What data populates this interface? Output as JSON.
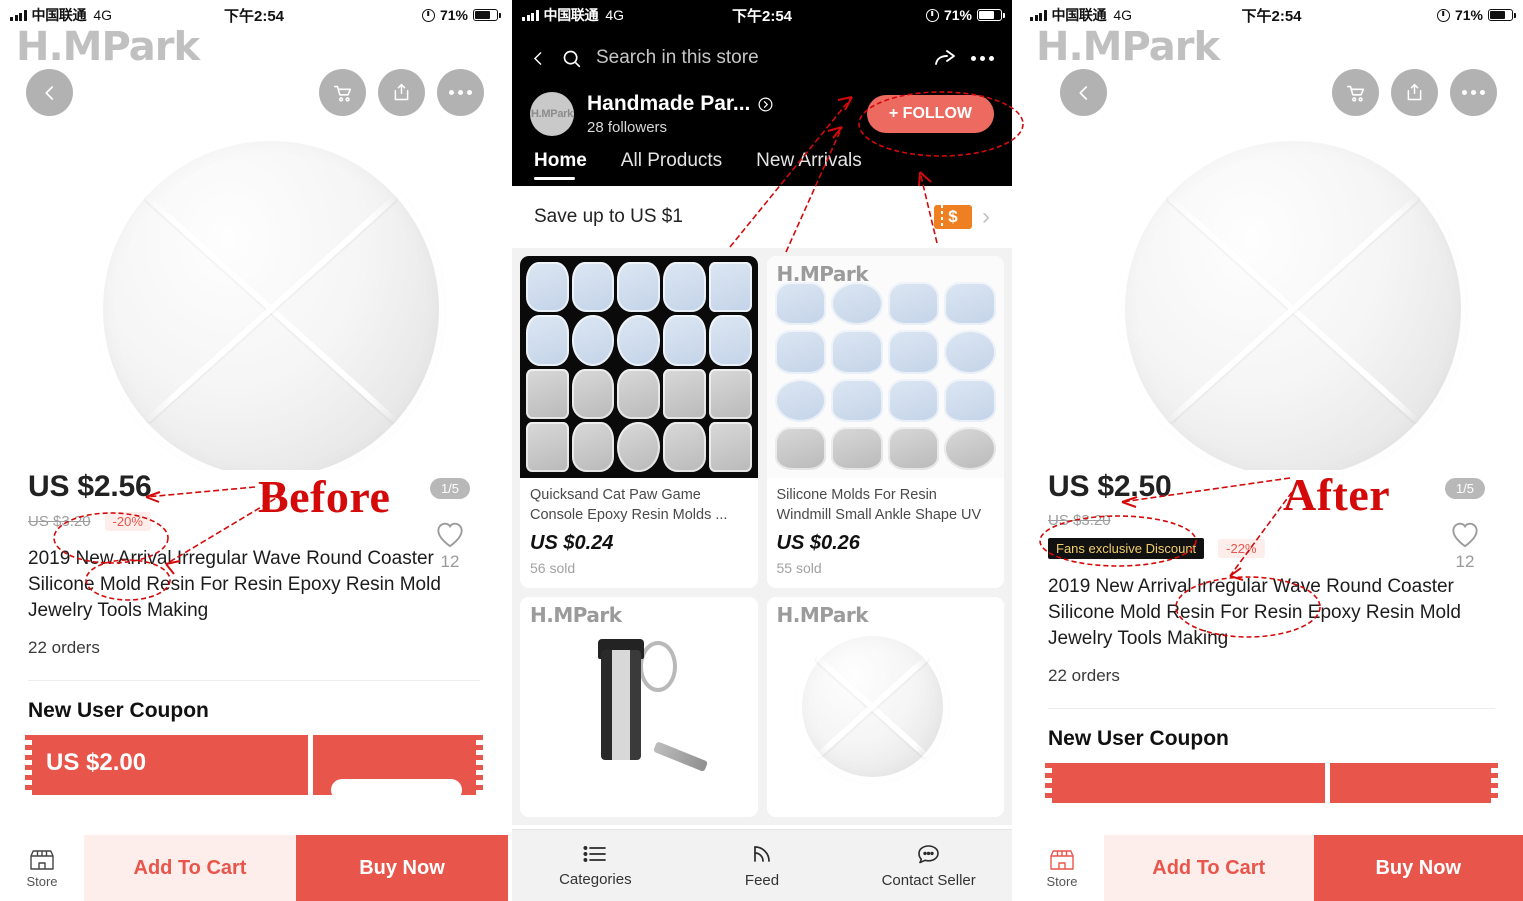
{
  "status_bar": {
    "carrier": "中国联通",
    "network": "4G",
    "time": "下午2:54",
    "battery_pct": "71%",
    "lock_icon": "rotation-lock-icon",
    "signal_icon": "signal-bars-icon",
    "battery_icon": "battery-icon"
  },
  "left_panel": {
    "label": "Before",
    "watermark": "H.MPark",
    "hero": {
      "back_icon": "back-chevron-icon",
      "cart_icon": "shopping-cart-icon",
      "share_icon": "share-icon",
      "more_icon": "more-dots-icon",
      "product_image": "round-coaster-silicone-mold"
    },
    "pager": "1/5",
    "favorite_icon": "heart-outline-icon",
    "favorite_count": "12",
    "price": "US $2.56",
    "price_old": "US $3.20",
    "discount": "-20%",
    "title": "2019 New Arrival Irregular Wave Round Coaster Silicone Mold Resin For Resin  Epoxy Resin Mold Jewelry Tools Making",
    "orders": "22 orders",
    "coupon_heading": "New User Coupon",
    "coupon_amount": "US $2.00",
    "bottom_bar": {
      "store_label": "Store",
      "store_icon": "storefront-icon",
      "add_to_cart": "Add To Cart",
      "buy_now": "Buy Now"
    }
  },
  "right_panel": {
    "label": "After",
    "watermark": "H.MPark",
    "hero": {
      "back_icon": "back-chevron-icon",
      "cart_icon": "shopping-cart-icon",
      "share_icon": "share-icon",
      "more_icon": "more-dots-icon",
      "product_image": "round-coaster-silicone-mold"
    },
    "pager": "1/5",
    "favorite_icon": "heart-outline-icon",
    "favorite_count": "12",
    "price": "US $2.50",
    "price_old": "US $3.20",
    "fans_badge": "Fans exclusive Discount",
    "discount": "-22%",
    "title": "2019 New Arrival Irregular Wave Round Coaster Silicone Mold Resin For Resin  Epoxy Resin Mold Jewelry Tools Making",
    "orders": "22 orders",
    "coupon_heading": "New User Coupon",
    "bottom_bar": {
      "store_label": "Store",
      "store_icon": "storefront-icon",
      "add_to_cart": "Add To Cart",
      "buy_now": "Buy Now"
    }
  },
  "middle_panel": {
    "header": {
      "back_icon": "back-chevron-icon",
      "search_icon": "search-icon",
      "search_placeholder": "Search in this store",
      "share_icon": "share-arrow-icon",
      "more_icon": "more-dots-icon",
      "avatar_text": "H.MPark",
      "store_name": "Handmade Par...",
      "store_info_icon": "chevron-right-circle-icon",
      "followers": "28  followers",
      "follow_button": "+ FOLLOW",
      "tabs": [
        {
          "label": "Home",
          "active": true
        },
        {
          "label": "All Products",
          "active": false
        },
        {
          "label": "New Arrivals",
          "active": false
        }
      ]
    },
    "save_bar": {
      "text": "Save up to US $1",
      "coupon_icon": "dollar-coupon-icon",
      "coupon_glyph": "$",
      "chevron_icon": "chevron-right-icon"
    },
    "products": [
      {
        "title": "Quicksand Cat Paw Game Console Epoxy Resin Molds ...",
        "price": "US $0.24",
        "sold": "56 sold",
        "image": "cat-paw-game-console-mold-sheet-dark",
        "watermark": ""
      },
      {
        "title": "Silicone Molds For Resin Windmill Small Ankle Shape UV ...",
        "price": "US $0.26",
        "sold": "55 sold",
        "image": "assorted-shape-molds-sheet-light",
        "watermark": "H.MPark"
      },
      {
        "title": "",
        "price": "",
        "sold": "",
        "image": "keychain-capsule-product",
        "watermark": "H.MPark"
      },
      {
        "title": "",
        "price": "",
        "sold": "",
        "image": "round-coaster-silicone-mold",
        "watermark": "H.MPark"
      }
    ],
    "bottom_nav": [
      {
        "label": "Categories",
        "icon": "list-icon"
      },
      {
        "label": "Feed",
        "icon": "rss-feed-icon"
      },
      {
        "label": "Contact Seller",
        "icon": "chat-bubble-icon"
      }
    ]
  },
  "annotations": {
    "before_label": "Before",
    "after_label": "After",
    "color": "#d40a0a"
  },
  "colors": {
    "brand_red": "#e8554b",
    "follow_red": "#ed6a60",
    "coupon_orange": "#ef8021",
    "fans_badge_bg": "#111111",
    "fans_badge_text": "#f3cf6a",
    "annotation_red": "#d40a0a"
  }
}
